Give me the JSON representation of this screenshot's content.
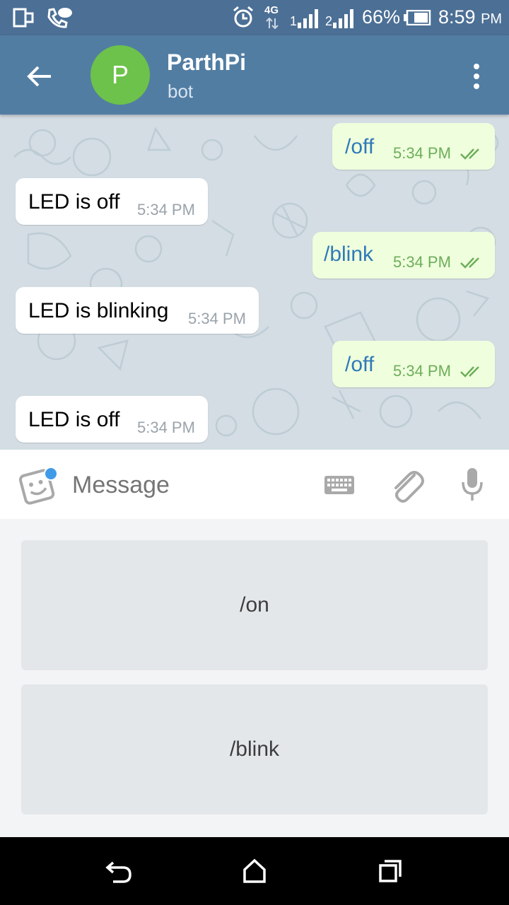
{
  "status_bar": {
    "network": "4G",
    "sim1": "1",
    "sim2": "2",
    "battery": "66%",
    "time": "8:59",
    "ampm": "PM"
  },
  "header": {
    "avatar_letter": "P",
    "title": "ParthPi",
    "subtitle": "bot"
  },
  "messages": [
    {
      "text": "/off",
      "time": "5:34 PM",
      "direction": "outgoing"
    },
    {
      "text": "LED is off",
      "time": "5:34 PM",
      "direction": "incoming"
    },
    {
      "text": "/blink",
      "time": "5:34 PM",
      "direction": "outgoing"
    },
    {
      "text": "LED is blinking",
      "time": "5:34 PM",
      "direction": "incoming"
    },
    {
      "text": "/off",
      "time": "5:34 PM",
      "direction": "outgoing"
    },
    {
      "text": "LED is off",
      "time": "5:34 PM",
      "direction": "incoming"
    }
  ],
  "composer": {
    "placeholder": "Message"
  },
  "bot_keyboard": [
    {
      "label": "/on"
    },
    {
      "label": "/blink"
    }
  ],
  "colors": {
    "appbar": "#527da3",
    "statusbar": "#4c6f95",
    "avatar": "#6cc24a",
    "outgoing_bubble": "#effedd",
    "incoming_bubble": "#ffffff"
  }
}
